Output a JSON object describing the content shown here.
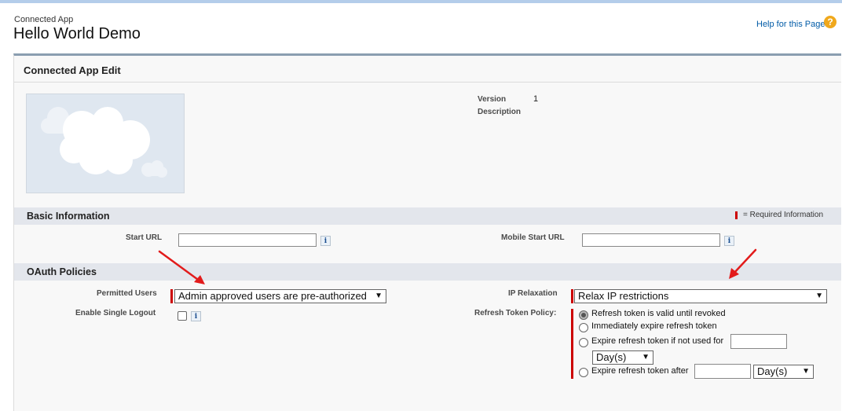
{
  "header": {
    "object_type": "Connected App",
    "title": "Hello World Demo",
    "help_link": "Help for this Page",
    "help_icon": "question-icon"
  },
  "card": {
    "title": "Connected App Edit"
  },
  "details": {
    "version_label": "Version",
    "version_value": "1",
    "description_label": "Description"
  },
  "basic_info": {
    "title": "Basic Information",
    "required_legend": "= Required Information",
    "start_url_label": "Start URL",
    "start_url_value": "",
    "mobile_start_url_label": "Mobile Start URL",
    "mobile_start_url_value": ""
  },
  "oauth": {
    "title": "OAuth Policies",
    "permitted_users_label": "Permitted Users",
    "permitted_users_value": "Admin approved users are pre-authorized",
    "enable_single_logout_label": "Enable Single Logout",
    "ip_relaxation_label": "IP Relaxation",
    "ip_relaxation_value": "Relax IP restrictions",
    "refresh_policy_label": "Refresh Token Policy:",
    "refresh_options": [
      "Refresh token is valid until revoked",
      "Immediately expire refresh token",
      "Expire refresh token if not used for",
      "Expire refresh token after"
    ],
    "selected_option_index": 0,
    "unit_value": "Day(s)",
    "unit_value_2": "Day(s)"
  },
  "info_button_glyph": "i",
  "colors": {
    "required": "#cc0000",
    "arrow": "#e21b1b",
    "link": "#015ba7",
    "section_bg": "#e3e6ec"
  }
}
